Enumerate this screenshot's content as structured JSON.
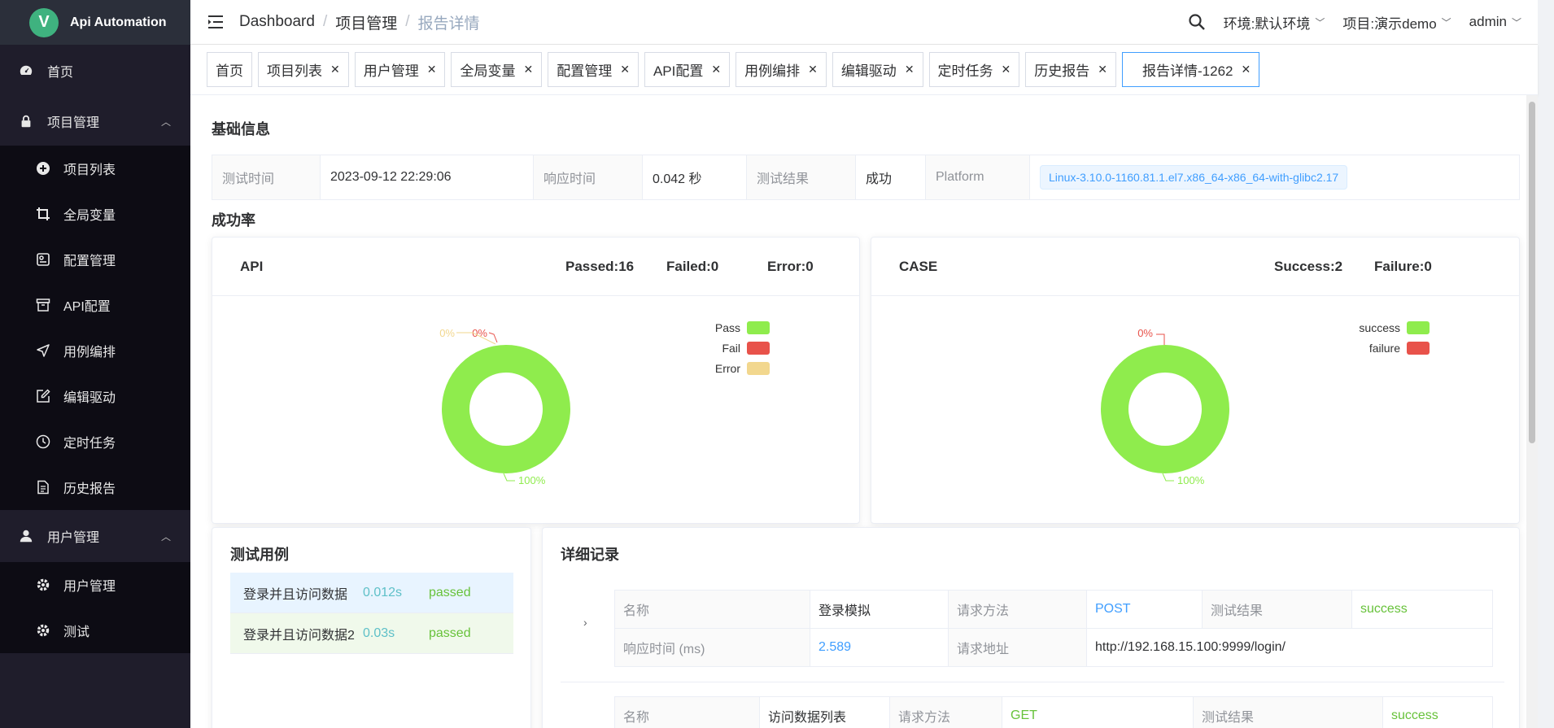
{
  "app": {
    "title": "Api Automation",
    "logo_letter": "V"
  },
  "sidebar": {
    "home": "首页",
    "project_group": "项目管理",
    "project_items": [
      "项目列表",
      "全局变量",
      "配置管理",
      "API配置",
      "用例编排",
      "编辑驱动",
      "定时任务",
      "历史报告"
    ],
    "user_group": "用户管理",
    "user_items": [
      "用户管理",
      "测试"
    ]
  },
  "header": {
    "breadcrumb": [
      "Dashboard",
      "项目管理",
      "报告详情"
    ],
    "env": "环境:默认环境",
    "project": "项目:演示demo",
    "user": "admin"
  },
  "tags": [
    "首页",
    "项目列表",
    "用户管理",
    "全局变量",
    "配置管理",
    "API配置",
    "用例编排",
    "编辑驱动",
    "定时任务",
    "历史报告",
    "报告详情-1262"
  ],
  "basic": {
    "title": "基础信息",
    "test_time_label": "测试时间",
    "test_time": "2023-09-12 22:29:06",
    "resp_time_label": "响应时间",
    "resp_time": "0.042 秒",
    "result_label": "测试结果",
    "result": "成功",
    "platform_label": "Platform",
    "platform": "Linux-3.10.0-1160.81.1.el7.x86_64-x86_64-with-glibc2.17"
  },
  "rate": {
    "title": "成功率",
    "api": {
      "title": "API",
      "passed": "Passed:16",
      "failed": "Failed:0",
      "error": "Error:0",
      "legend": [
        "Pass",
        "Fail",
        "Error"
      ],
      "labels": [
        "0%",
        "0%",
        "100%"
      ]
    },
    "case": {
      "title": "CASE",
      "success": "Success:2",
      "failure": "Failure:0",
      "legend": [
        "success",
        "failure"
      ],
      "labels": [
        "0%",
        "100%"
      ]
    }
  },
  "chart_data": [
    {
      "type": "pie",
      "title": "API",
      "categories": [
        "Pass",
        "Fail",
        "Error"
      ],
      "values": [
        16,
        0,
        0
      ],
      "colors": [
        "#8fec4d",
        "#e8524a",
        "#f2d78e"
      ]
    },
    {
      "type": "pie",
      "title": "CASE",
      "categories": [
        "success",
        "failure"
      ],
      "values": [
        2,
        0
      ],
      "colors": [
        "#8fec4d",
        "#e8524a"
      ]
    }
  ],
  "cases": {
    "title": "测试用例",
    "rows": [
      {
        "name": "登录并且访问数据",
        "time": "0.012s",
        "status": "passed"
      },
      {
        "name": "登录并且访问数据2",
        "time": "0.03s",
        "status": "passed"
      }
    ]
  },
  "details": {
    "title": "详细记录",
    "records": [
      {
        "name_label": "名称",
        "name": "登录模拟",
        "method_label": "请求方法",
        "method": "POST",
        "result_label": "测试结果",
        "result": "success",
        "resp_label": "响应时间 (ms)",
        "resp": "2.589",
        "url_label": "请求地址",
        "url": "http://192.168.15.100:9999/login/"
      },
      {
        "name_label": "名称",
        "name": "访问数据列表",
        "method_label": "请求方法",
        "method": "GET",
        "result_label": "测试结果",
        "result": "success"
      }
    ]
  }
}
